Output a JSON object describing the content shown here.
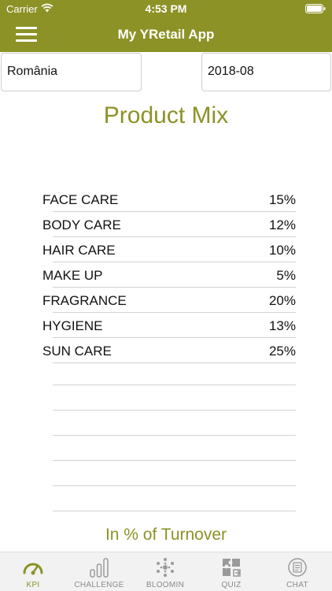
{
  "status_bar": {
    "carrier": "Carrier",
    "time": "4:53 PM"
  },
  "header": {
    "title": "My YRetail App",
    "menu_icon": "hamburger-menu-icon"
  },
  "filters": {
    "country": "România",
    "period": "2018-08"
  },
  "page": {
    "title": "Product Mix",
    "footnote": "In % of Turnover"
  },
  "product_mix": [
    {
      "name": "FACE CARE",
      "value": "15%"
    },
    {
      "name": "BODY CARE",
      "value": "12%"
    },
    {
      "name": "HAIR CARE",
      "value": "10%"
    },
    {
      "name": "MAKE UP",
      "value": "5%"
    },
    {
      "name": "FRAGRANCE",
      "value": "20%"
    },
    {
      "name": "HYGIENE",
      "value": "13%"
    },
    {
      "name": "SUN CARE",
      "value": "25%"
    }
  ],
  "tabs": [
    {
      "label": "KPI",
      "icon": "gauge-icon",
      "active": true
    },
    {
      "label": "CHALLENGE",
      "icon": "bar-chart-icon",
      "active": false
    },
    {
      "label": "BLOOMIN",
      "icon": "network-icon",
      "active": false
    },
    {
      "label": "QUIZ",
      "icon": "puzzle-icon",
      "active": false
    },
    {
      "label": "CHAT",
      "icon": "chat-icon",
      "active": false
    }
  ],
  "colors": {
    "brand": "#8c9226",
    "tab_inactive": "#8a8a8a",
    "divider": "#d2d2d2"
  }
}
